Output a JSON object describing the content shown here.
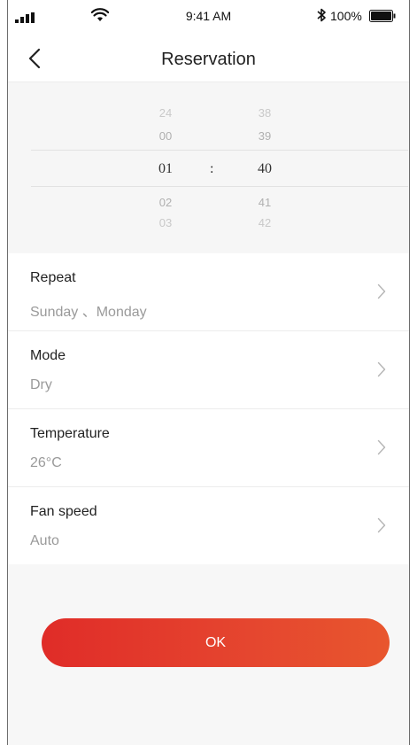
{
  "status_bar": {
    "time": "9:41 AM",
    "battery": "100%"
  },
  "nav": {
    "title": "Reservation"
  },
  "picker": {
    "hours": [
      "24",
      "00",
      "01",
      "02",
      "03"
    ],
    "minutes": [
      "38",
      "39",
      "40",
      "41",
      "42"
    ],
    "separator": ":"
  },
  "settings": [
    {
      "label": "Repeat",
      "value": "Sunday 、Monday"
    },
    {
      "label": "Mode",
      "value": "Dry"
    },
    {
      "label": "Temperature",
      "value": "26°C"
    },
    {
      "label": "Fan speed",
      "value": "Auto"
    }
  ],
  "ok_label": "OK",
  "colors": {
    "accent_start": "#e02c28",
    "accent_end": "#e8562e"
  }
}
